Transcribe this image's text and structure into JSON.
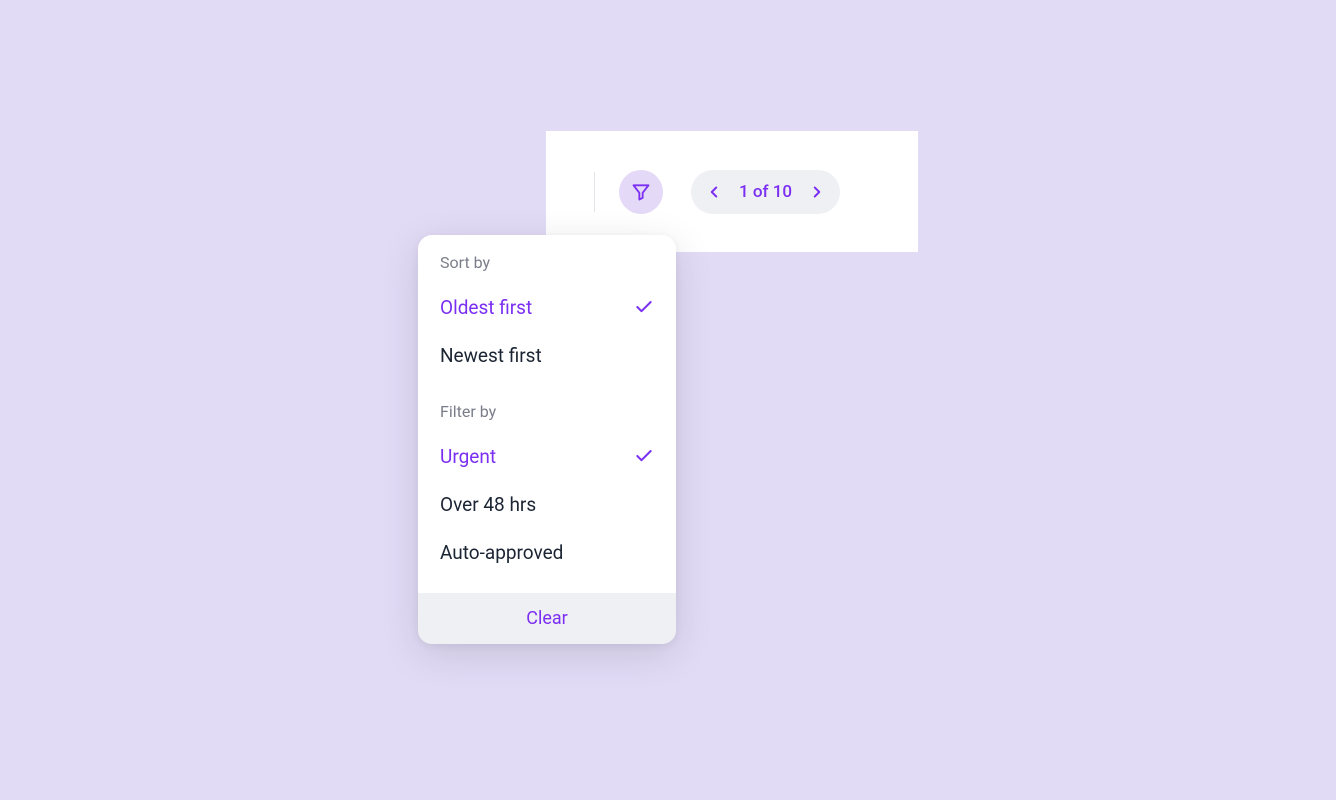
{
  "toolbar": {
    "pager_text": "1 of 10"
  },
  "popover": {
    "sort_label": "Sort by",
    "sort_items": [
      {
        "label": "Oldest first",
        "selected": true
      },
      {
        "label": "Newest first",
        "selected": false
      }
    ],
    "filter_label": "Filter by",
    "filter_items": [
      {
        "label": "Urgent",
        "selected": true
      },
      {
        "label": "Over 48 hrs",
        "selected": false
      },
      {
        "label": "Auto-approved",
        "selected": false
      }
    ],
    "clear_label": "Clear"
  },
  "colors": {
    "accent": "#7B2FF2",
    "bg": "#E2DBF6"
  }
}
